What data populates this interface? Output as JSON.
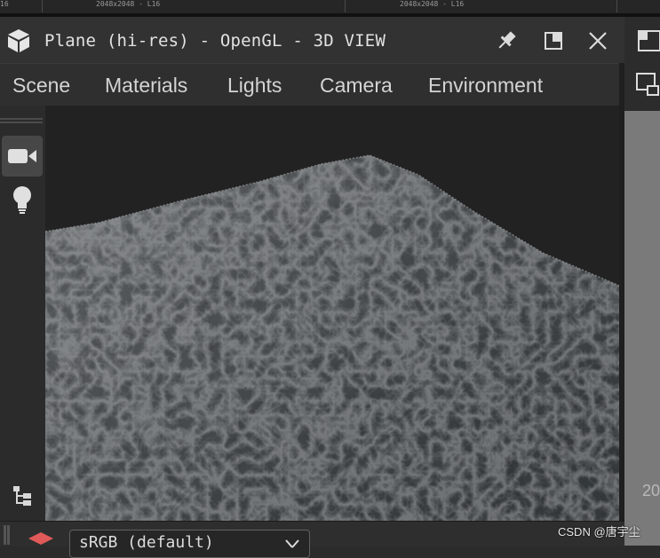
{
  "top_strip": {
    "left_fragment": "16",
    "res_1": "2048x2048 - L16",
    "res_2": "2048x2048 - L16"
  },
  "window": {
    "title": "Plane (hi-res) - OpenGL - 3D VIEW"
  },
  "title_buttons": {
    "pin": "pin-icon",
    "maximize": "maximize-icon",
    "close": "close-icon"
  },
  "menu": [
    "Scene",
    "Materials",
    "Lights",
    "Camera",
    "Environment"
  ],
  "left_toolbar": {
    "active": "camera-icon",
    "items": [
      "camera-icon",
      "light-bulb-icon"
    ],
    "bottom": "hierarchy-icon"
  },
  "bottom_bar": {
    "select_value": "sRGB (default)"
  },
  "right_panel": {
    "partial_text": "20"
  },
  "watermark": "CSDN @唐宇尘",
  "colors": {
    "background": "#2b2b2b",
    "titlebar": "#323232",
    "viewport_bg": "#222222",
    "text": "#d4d4d4"
  }
}
